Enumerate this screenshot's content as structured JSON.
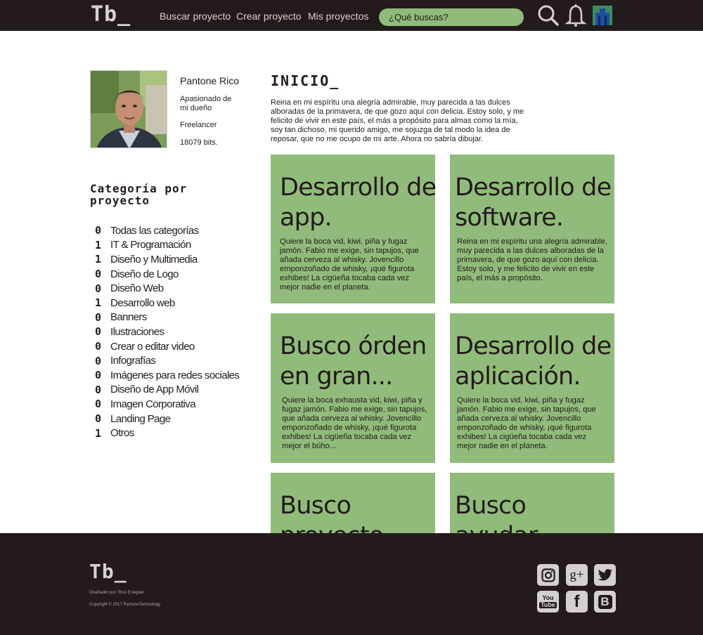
{
  "header": {
    "logo": "Tb_",
    "nav": [
      {
        "label": "Buscar proyecto"
      },
      {
        "label": "Crear proyecto"
      },
      {
        "label": "Mis proyectos"
      }
    ],
    "search_placeholder": "¿Qué buscas?",
    "icons": [
      "search-icon",
      "bell-icon",
      "user-avatar"
    ]
  },
  "profile": {
    "name": "Pantone Rico",
    "tagline": "Apasionado de mi dueño",
    "role": "Freelancer",
    "bits": "18079 bits."
  },
  "categories": {
    "title": "Categoría por proyecto",
    "items": [
      {
        "count": "0",
        "label": "Todas las categorías"
      },
      {
        "count": "1",
        "label": "IT & Programación"
      },
      {
        "count": "1",
        "label": "Diseño y Multimedia"
      },
      {
        "count": "0",
        "label": "Diseño de Logo"
      },
      {
        "count": "0",
        "label": "Diseño Web"
      },
      {
        "count": "1",
        "label": "Desarrollo web"
      },
      {
        "count": "0",
        "label": "Banners"
      },
      {
        "count": "0",
        "label": "Ilustraciones"
      },
      {
        "count": "0",
        "label": "Crear o editar video"
      },
      {
        "count": "0",
        "label": "Infografías"
      },
      {
        "count": "0",
        "label": "Imágenes para redes sociales"
      },
      {
        "count": "0",
        "label": "Diseño de App Móvil"
      },
      {
        "count": "0",
        "label": "Imagen Corporativa"
      },
      {
        "count": "0",
        "label": "Landing Page"
      },
      {
        "count": "1",
        "label": "Otros"
      }
    ]
  },
  "main": {
    "title": "INICIO_",
    "intro": "Reina en mi espíritu una alegría admirable, muy parecida a las dulces alboradas de la primavera, de que gozo aquí con delicia. Estoy solo, y me felicito de vivir en este país, el más a propósito para almas como la mía, soy tan dichoso, mi querido amigo, me sojuzga de tal modo la idea de reposar, que no me ocupo de mi arte. Ahora no sabría dibujar.",
    "cards": [
      {
        "title": "Desarrollo de app.",
        "desc": "Quiere la boca vid, kiwi, piña y fugaz jamón. Fabio me exige, sin tapujos, que añada cerveza al whisky. Jovencillo emponzoñado de whisky, ¡qué figurota exhibes! La cigüeña tocaba cada vez mejor nadie en el planeta."
      },
      {
        "title": "Desarrollo de software.",
        "desc": "Reina en mi espíritu una alegría admirable, muy parecida a las dulces alboradas de la primavera, de que gozo aquí con delicia. Estoy solo, y me felicito de vivir en este país, el más a propósito."
      },
      {
        "title": "Busco órden en gran...",
        "desc": "Quiere la boca exhausta vid, kiwi, piña y fugaz jamón. Fabio me exige, sin tapujos, que añada cerveza al whisky. Jovencillo emponzoñado de whisky, ¡qué figurota exhibes! La cigüeña tocaba cada vez mejor el búho..."
      },
      {
        "title": "Desarrollo de aplicación.",
        "desc": "Quiere la boca vid, kiwi, piña y fugaz jamón. Fabio me exige, sin tapujos, que añada cerveza al whisky. Jovencillo emponzoñado de whisky, ¡qué figurota exhibes! La cigüeña tocaba cada vez mejor nadie en el planeta."
      },
      {
        "title": "Busco proyecto",
        "desc": ""
      },
      {
        "title": "Busco ayudar",
        "desc": ""
      }
    ]
  },
  "footer": {
    "logo": "Tb_",
    "designer": "Diseñador por: Rico Ezequiel",
    "copyright": "Copyright © 2017 PantoneTechnology",
    "social": [
      {
        "icon": "instagram-icon"
      },
      {
        "icon": "google-plus-icon",
        "glyph": "g+"
      },
      {
        "icon": "twitter-icon"
      },
      {
        "icon": "youtube-icon",
        "glyph1": "You",
        "glyph2": "Tube"
      },
      {
        "icon": "facebook-icon",
        "glyph": "f"
      },
      {
        "icon": "blogger-icon",
        "glyph": "B"
      }
    ]
  },
  "colors": {
    "dark": "#231b1b",
    "green": "#91bb7a",
    "icon_light": "#d5cfcf"
  }
}
